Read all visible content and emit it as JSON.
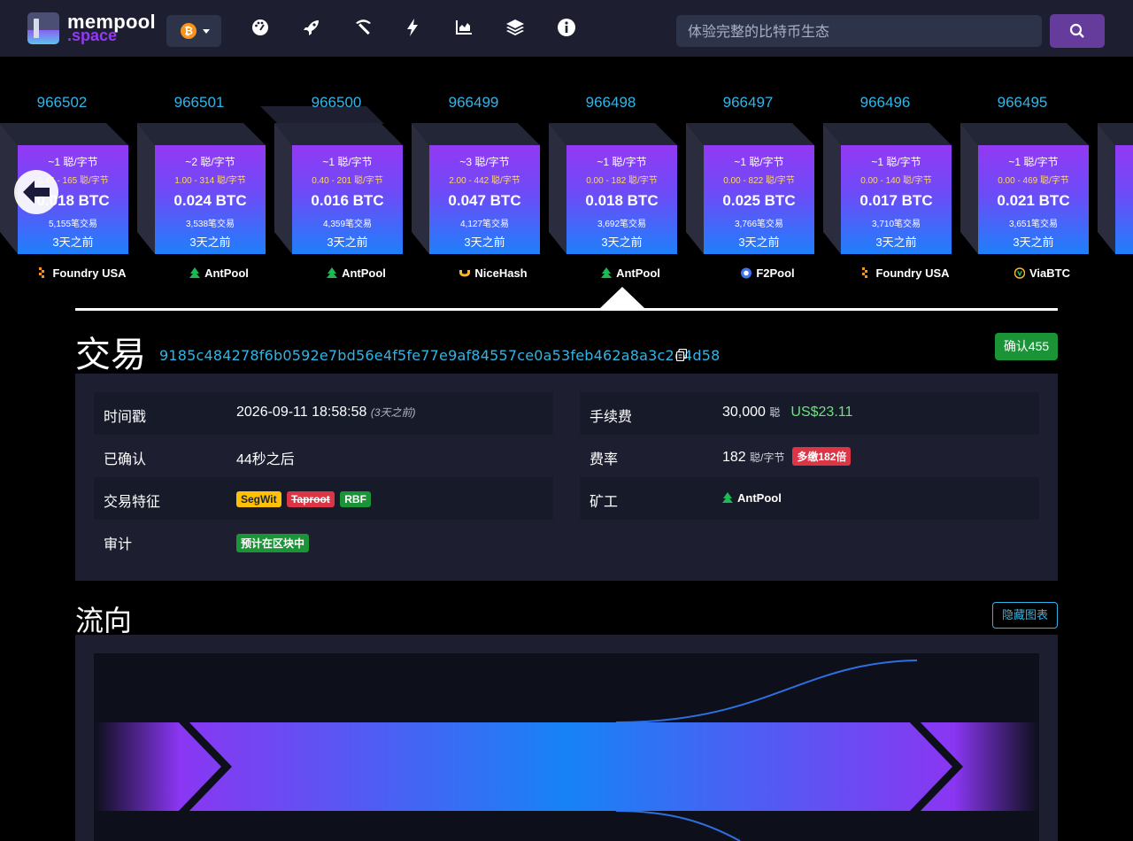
{
  "navbar": {
    "logo_line1": "mempool",
    "logo_line2": ".space",
    "network_icon": "bitcoin-icon",
    "nav_icons": [
      "dashboard-icon",
      "rocket-icon",
      "pickaxe-icon",
      "lightning-icon",
      "chart-icon",
      "layers-icon",
      "info-icon"
    ],
    "search_placeholder": "体验完整的比特币生态"
  },
  "blocks": [
    {
      "height": "966502",
      "fee_median": "~1 聪/字节",
      "fee_range": "0.45 - 165 聪/字节",
      "total": "0.018 BTC",
      "tx_count": "5,155笔交易",
      "time": "3天之前",
      "pool": "Foundry USA"
    },
    {
      "height": "966501",
      "fee_median": "~2 聪/字节",
      "fee_range": "1.00 - 314 聪/字节",
      "total": "0.024 BTC",
      "tx_count": "3,538笔交易",
      "time": "3天之前",
      "pool": "AntPool"
    },
    {
      "height": "966500",
      "fee_median": "~1 聪/字节",
      "fee_range": "0.40 - 201 聪/字节",
      "total": "0.016 BTC",
      "tx_count": "4,359笔交易",
      "time": "3天之前",
      "pool": "AntPool"
    },
    {
      "height": "966499",
      "fee_median": "~3 聪/字节",
      "fee_range": "2.00 - 442 聪/字节",
      "total": "0.047 BTC",
      "tx_count": "4,127笔交易",
      "time": "3天之前",
      "pool": "NiceHash"
    },
    {
      "height": "966498",
      "fee_median": "~1 聪/字节",
      "fee_range": "0.00 - 182 聪/字节",
      "total": "0.018 BTC",
      "tx_count": "3,692笔交易",
      "time": "3天之前",
      "pool": "AntPool"
    },
    {
      "height": "966497",
      "fee_median": "~1 聪/字节",
      "fee_range": "0.00 - 822 聪/字节",
      "total": "0.025 BTC",
      "tx_count": "3,766笔交易",
      "time": "3天之前",
      "pool": "F2Pool"
    },
    {
      "height": "966496",
      "fee_median": "~1 聪/字节",
      "fee_range": "0.00 - 140 聪/字节",
      "total": "0.017 BTC",
      "tx_count": "3,710笔交易",
      "time": "3天之前",
      "pool": "Foundry USA"
    },
    {
      "height": "966495",
      "fee_median": "~1 聪/字节",
      "fee_range": "0.00 - 469 聪/字节",
      "total": "0.021 BTC",
      "tx_count": "3,651笔交易",
      "time": "3天之前",
      "pool": "ViaBTC"
    }
  ],
  "tx": {
    "title": "交易",
    "txid": "9185c484278f6b0592e7bd56e4f5fe77e9af84557ce0a53feb462a8a3c2e4d58",
    "confirmations": "确认455",
    "left_rows": {
      "timestamp_label": "时间戳",
      "timestamp_value": "2026-09-11 18:58:58",
      "timestamp_ago": "(3天之前)",
      "confirmed_label": "已确认",
      "confirmed_value": "44秒之后",
      "features_label": "交易特征",
      "features": [
        "SegWit",
        "Taproot",
        "RBF"
      ],
      "audit_label": "审计",
      "audit_badge": "预计在区块中"
    },
    "right_rows": {
      "fee_label": "手续费",
      "fee_value": "30,000",
      "fee_unit": "聪",
      "fee_usd": "US$23.11",
      "rate_label": "费率",
      "rate_value": "182",
      "rate_unit": "聪/字节",
      "rate_badge": "多缴182倍",
      "miner_label": "矿工",
      "miner_value": "AntPool"
    }
  },
  "flow": {
    "title": "流向",
    "hide_button": "隐藏图表"
  },
  "colors": {
    "accent_blue": "#2fb5e8",
    "purple": "#9339f4",
    "confirm_green": "#1a9436",
    "usd_green": "#6de37e"
  }
}
